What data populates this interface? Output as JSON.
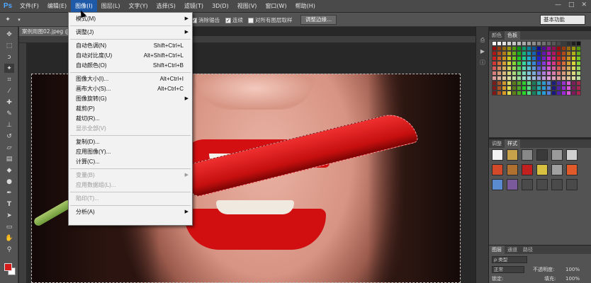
{
  "app": {
    "logo": "Ps"
  },
  "menubar": {
    "items": [
      "文件(F)",
      "编辑(E)",
      "图像(I)",
      "图层(L)",
      "文字(Y)",
      "选择(S)",
      "滤镜(T)",
      "3D(D)",
      "视图(V)",
      "窗口(W)",
      "帮助(H)"
    ],
    "active_index": 2
  },
  "window_controls": {
    "minimize": "—",
    "restore": "□",
    "close": "✕"
  },
  "options_bar": {
    "anti_alias": "消除锯齿",
    "contiguous": "连续",
    "sample_all_layers": "对所有图层取样",
    "refine_edge": "调整边缘...",
    "workspace": "基本功能"
  },
  "document": {
    "tab_title": "案例用图02.jpeg @"
  },
  "image_menu": {
    "items": [
      {
        "label": "模式(M)",
        "submenu": true
      },
      {
        "sep": true
      },
      {
        "label": "调整(J)",
        "submenu": true
      },
      {
        "sep": true
      },
      {
        "label": "自动色调(N)",
        "shortcut": "Shift+Ctrl+L"
      },
      {
        "label": "自动对比度(U)",
        "shortcut": "Alt+Shift+Ctrl+L"
      },
      {
        "label": "自动颜色(O)",
        "shortcut": "Shift+Ctrl+B"
      },
      {
        "sep": true
      },
      {
        "label": "图像大小(I)...",
        "shortcut": "Alt+Ctrl+I"
      },
      {
        "label": "画布大小(S)...",
        "shortcut": "Alt+Ctrl+C"
      },
      {
        "label": "图像旋转(G)",
        "submenu": true
      },
      {
        "label": "裁剪(P)"
      },
      {
        "label": "裁切(R)..."
      },
      {
        "label": "显示全部(V)",
        "disabled": true
      },
      {
        "sep": true
      },
      {
        "label": "复制(D)..."
      },
      {
        "label": "应用图像(Y)..."
      },
      {
        "label": "计算(C)..."
      },
      {
        "sep": true
      },
      {
        "label": "变量(B)",
        "submenu": true,
        "disabled": true
      },
      {
        "label": "应用数据组(L)...",
        "disabled": true
      },
      {
        "sep": true
      },
      {
        "label": "陷印(T)...",
        "disabled": true
      },
      {
        "sep": true
      },
      {
        "label": "分析(A)",
        "submenu": true
      }
    ]
  },
  "panels": {
    "swatches": {
      "tabs": [
        "颜色",
        "色板"
      ],
      "active_tab": 1
    },
    "styles": {
      "tabs": [
        "调整",
        "样式"
      ],
      "active_tab": 1
    },
    "layers": {
      "tabs": [
        "图层",
        "通道",
        "路径"
      ],
      "kind_filter": "ρ 类型",
      "blend_mode": "正常",
      "opacity_label": "不透明度:",
      "opacity_value": "100%",
      "lock_label": "锁定:",
      "fill_label": "填充:",
      "fill_value": "100%"
    }
  },
  "colors": {
    "foreground": "#d61b1b",
    "background": "#ffffff",
    "menu_highlight": "#1e5aa8"
  }
}
